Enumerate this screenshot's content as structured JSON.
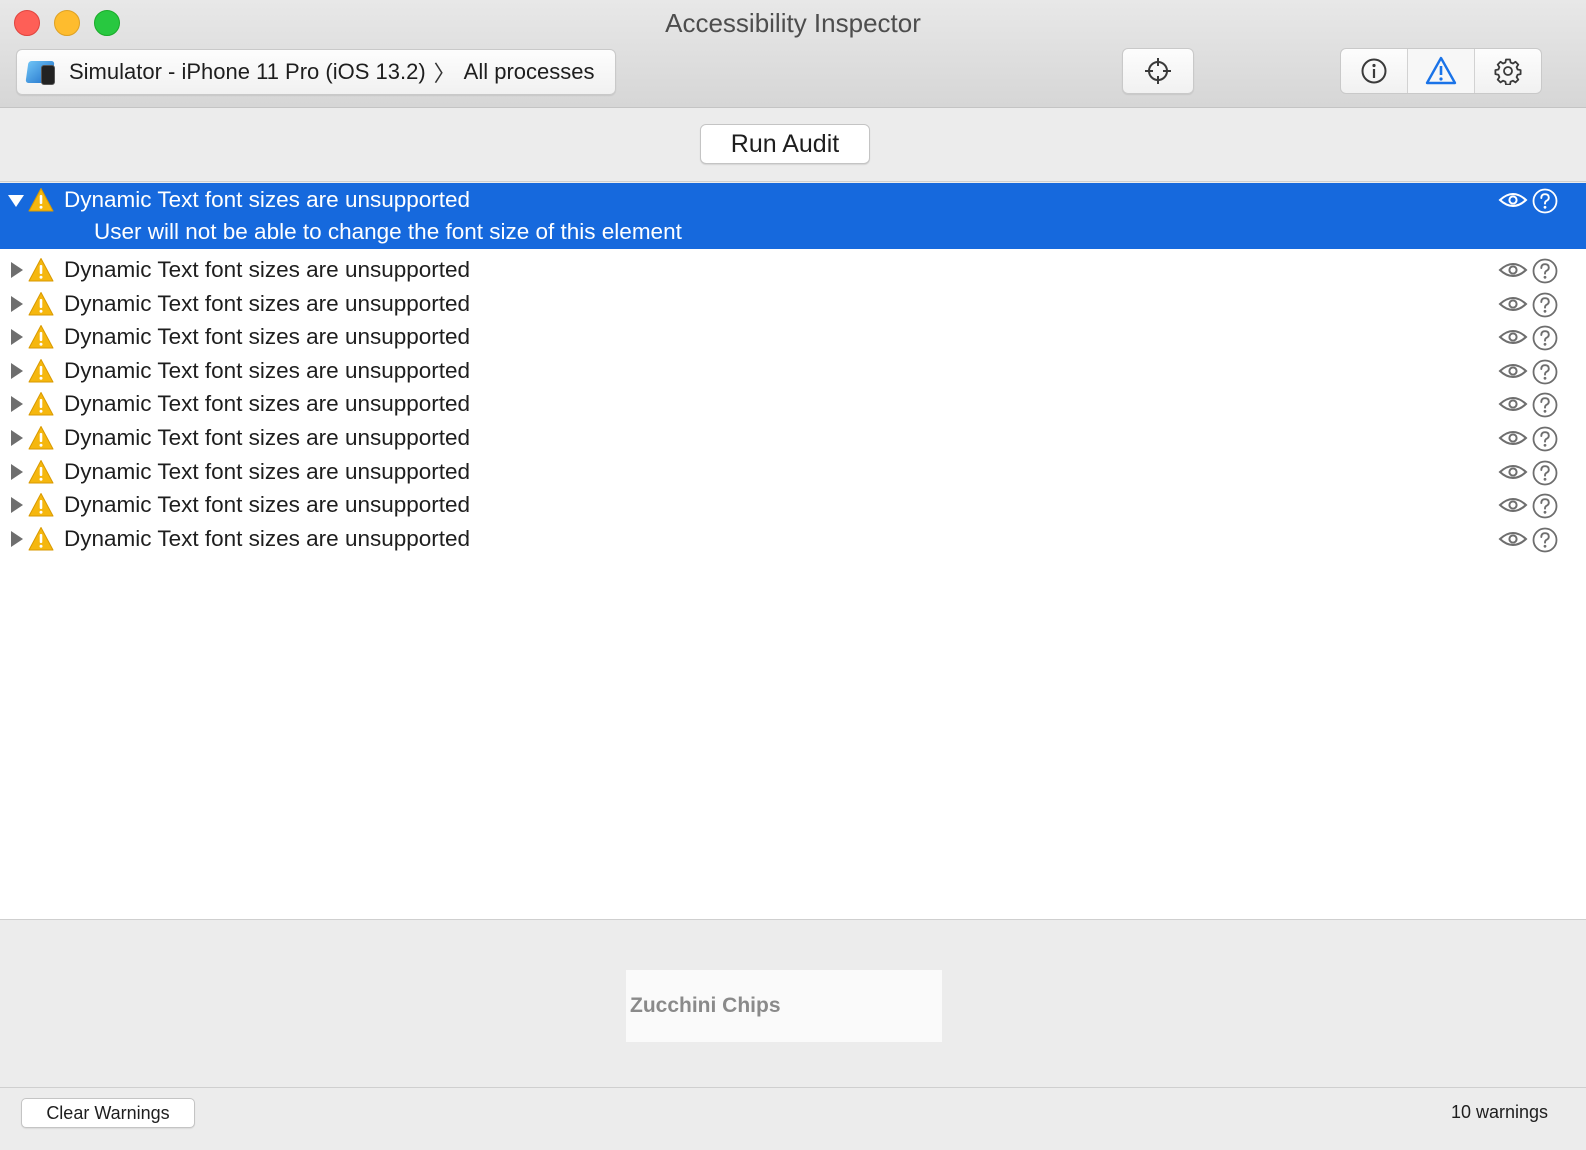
{
  "window": {
    "title": "Accessibility Inspector"
  },
  "toolbar": {
    "target_device": "Simulator - iPhone 11 Pro (iOS 13.2)",
    "target_separator": "〉",
    "target_process": "All processes",
    "icons": [
      "simulator-icon",
      "crosshair-icon",
      "info-icon",
      "warning-icon",
      "gear-icon"
    ],
    "accent_color": "#1a73e8"
  },
  "audit": {
    "run_label": "Run Audit"
  },
  "issues": [
    {
      "title": "Dynamic Text font sizes are unsupported",
      "detail": "User will not be able to change the font size of this element",
      "expanded": true,
      "selected": true
    },
    {
      "title": "Dynamic Text font sizes are unsupported",
      "expanded": false
    },
    {
      "title": "Dynamic Text font sizes are unsupported",
      "expanded": false
    },
    {
      "title": "Dynamic Text font sizes are unsupported",
      "expanded": false
    },
    {
      "title": "Dynamic Text font sizes are unsupported",
      "expanded": false
    },
    {
      "title": "Dynamic Text font sizes are unsupported",
      "expanded": false
    },
    {
      "title": "Dynamic Text font sizes are unsupported",
      "expanded": false
    },
    {
      "title": "Dynamic Text font sizes are unsupported",
      "expanded": false
    },
    {
      "title": "Dynamic Text font sizes are unsupported",
      "expanded": false
    },
    {
      "title": "Dynamic Text font sizes are unsupported",
      "expanded": false
    }
  ],
  "selection_color": "#1669dd",
  "warning_color": "#f5b70f",
  "preview": {
    "text": "Zucchini Chips"
  },
  "footer": {
    "clear_label": "Clear Warnings",
    "count_label": "10 warnings"
  }
}
